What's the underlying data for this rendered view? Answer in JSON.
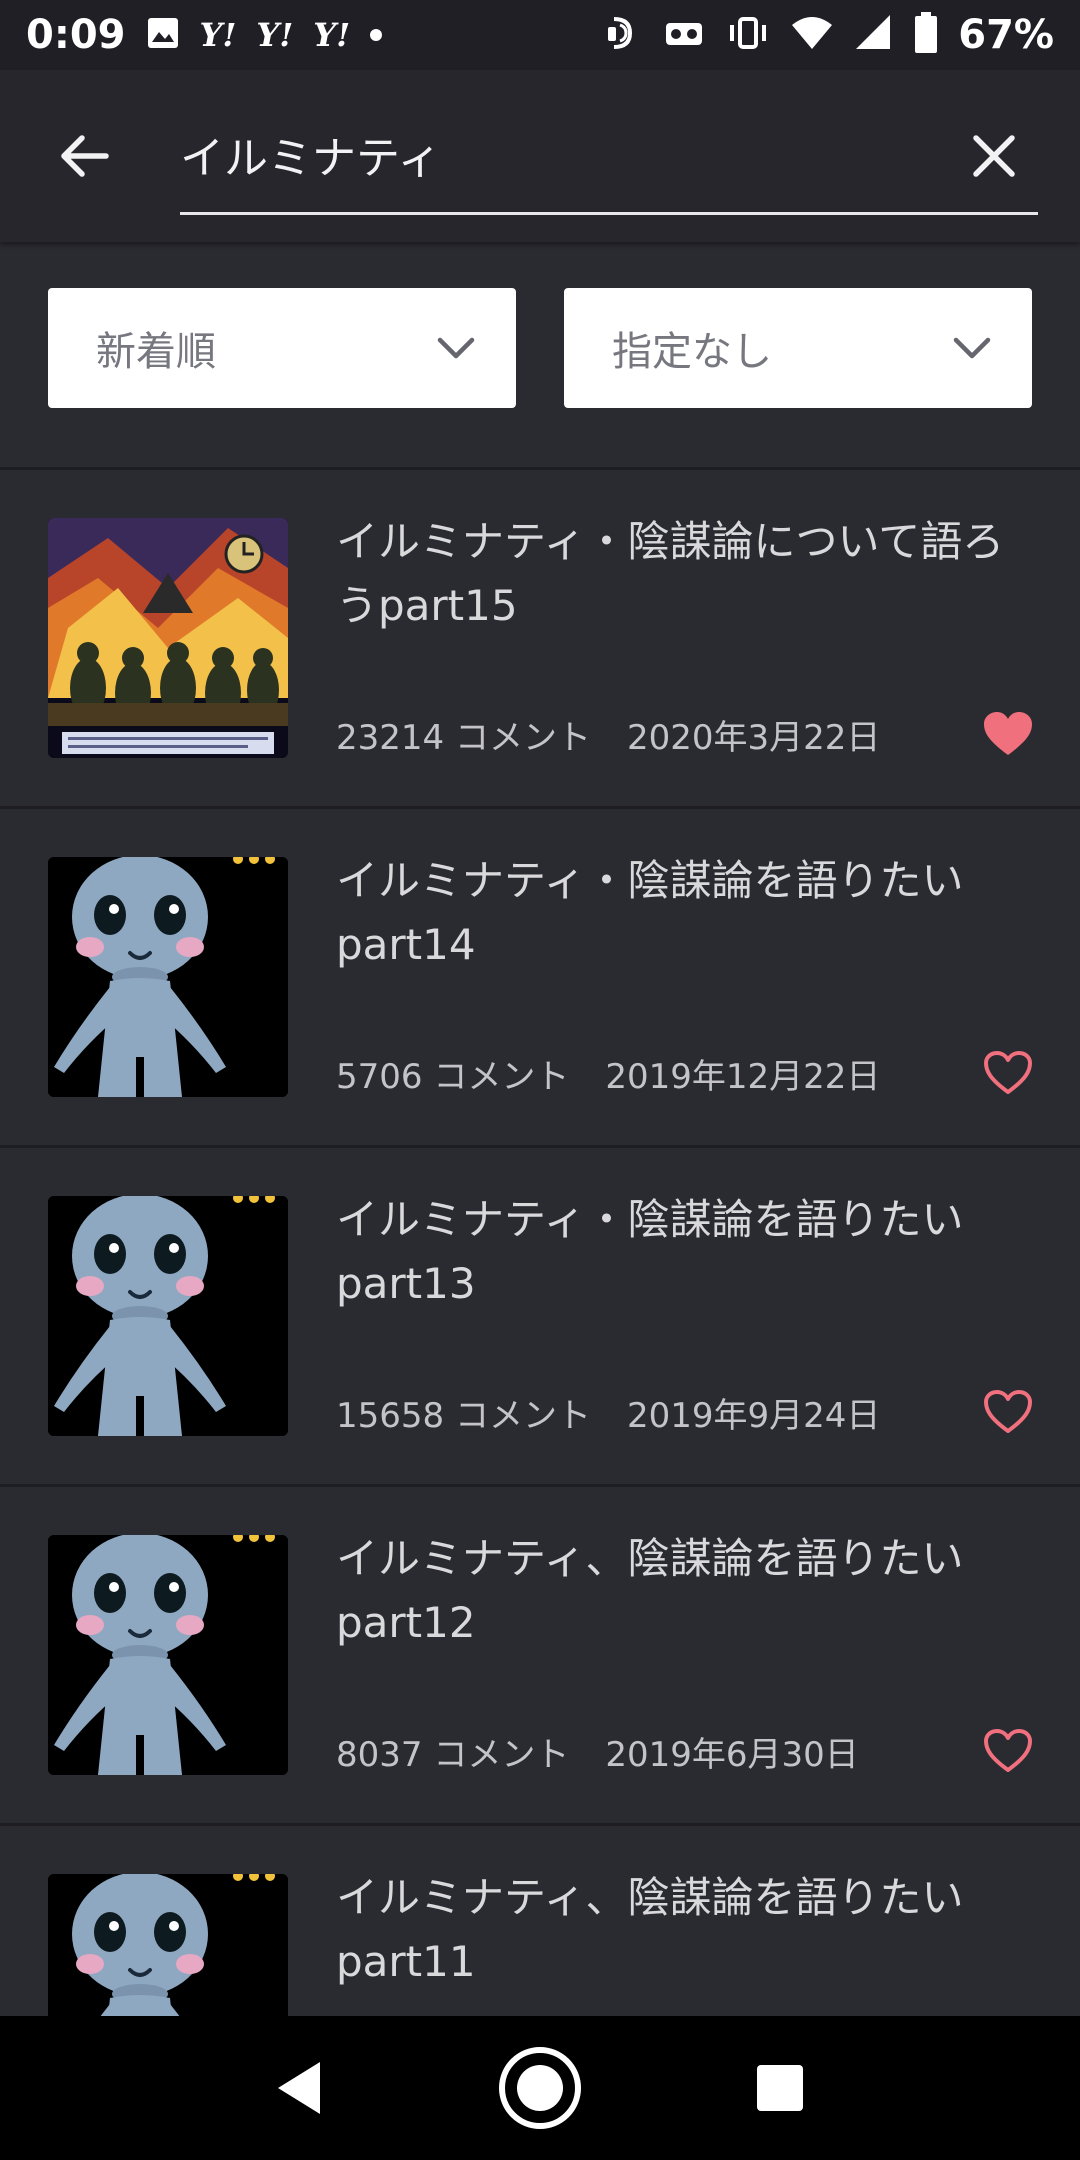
{
  "status_bar": {
    "time": "0:09",
    "yahoo_badges": [
      "Y!",
      "Y!",
      "Y!"
    ],
    "battery": "67%"
  },
  "search": {
    "query": "イルミナティ",
    "back_icon": "arrow-left-icon",
    "clear_icon": "close-icon"
  },
  "filters": {
    "sort_label": "新着順",
    "range_label": "指定なし"
  },
  "threads": [
    {
      "title": "イルミナティ・陰謀論について語ろうpart15",
      "comments": "23214 コメント",
      "date": "2020年3月22日",
      "favorited": true,
      "thumb": "art"
    },
    {
      "title": "イルミナティ・陰謀論を語りたいpart14",
      "comments": "5706 コメント",
      "date": "2019年12月22日",
      "favorited": false,
      "thumb": "alien"
    },
    {
      "title": "イルミナティ・陰謀論を語りたいpart13",
      "comments": "15658 コメント",
      "date": "2019年9月24日",
      "favorited": false,
      "thumb": "alien"
    },
    {
      "title": "イルミナティ、陰謀論を語りたいpart12",
      "comments": "8037 コメント",
      "date": "2019年6月30日",
      "favorited": false,
      "thumb": "alien"
    },
    {
      "title": "イルミナティ、陰謀論を語りたいpart11",
      "comments": "",
      "date": "",
      "favorited": false,
      "thumb": "alien"
    }
  ],
  "colors": {
    "background": "#2a2a31",
    "header": "#26262c",
    "heart": "#f0707e"
  }
}
